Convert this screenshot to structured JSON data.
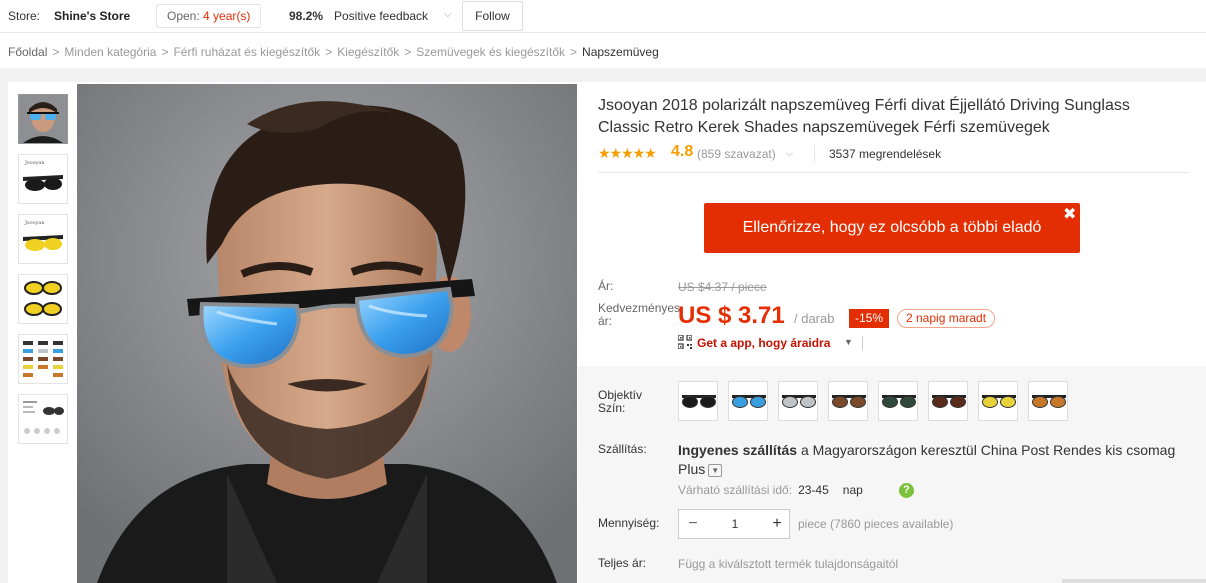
{
  "store": {
    "label": "Store:",
    "name": "Shine's Store",
    "open_prefix": "Open:",
    "open_years": "4 year(s)",
    "feedback_pct": "98.2%",
    "feedback_label": "Positive feedback",
    "follow_label": "Follow"
  },
  "breadcrumb": [
    "Főoldal",
    "Minden kategória",
    "Férfi ruházat és kiegészítők",
    "Kiegészítők",
    "Szemüvegek és kiegészítők",
    "Napszemüveg"
  ],
  "breadcrumb_separator": ">",
  "product": {
    "title": "Jsooyan 2018 polarizált napszemüveg Férfi divat Éjjellátó Driving Sunglass Classic Retro Kerek Shades napszemüvegek Férfi szemüvegek",
    "stars": "★★★★★",
    "rating": "4.8",
    "votes": "(859 szavazat)",
    "orders": "3537 megrendelések",
    "rating_value": 4.8
  },
  "cheaper_banner": "Ellenőrizze, hogy ez olcsóbb a többi eladó",
  "cheaper_close": "✖",
  "price": {
    "label": "Ár:",
    "old": "US $4.37 / piece",
    "discount_label": "Kedvezményes ár:",
    "new": "US $ 3.71",
    "per_unit": "/ darab",
    "discount_badge": "-15%",
    "days_left": "2 napig maradt",
    "app_link": "Get a app, hogy áraidra"
  },
  "options": {
    "label": "Objektív Szín:",
    "swatches": [
      {
        "name": "black",
        "lens": "#1b1b1b"
      },
      {
        "name": "blue",
        "lens": "#3a9fe0"
      },
      {
        "name": "silver",
        "lens": "#bfc4c8"
      },
      {
        "name": "brown",
        "lens": "#7a4a2a"
      },
      {
        "name": "green",
        "lens": "#2f4a3a"
      },
      {
        "name": "dark-brown",
        "lens": "#5a2a1a"
      },
      {
        "name": "yellow",
        "lens": "#e8d23a"
      },
      {
        "name": "orange",
        "lens": "#c8782a"
      }
    ]
  },
  "shipping": {
    "label": "Szállítás:",
    "free": "Ingyenes szállítás",
    "rest": " a Magyarországon keresztül China Post Rendes kis csomag Plus",
    "est_label": "Várható szállítási idő:",
    "est_days": "23-45",
    "est_unit": "nap",
    "help": "?"
  },
  "quantity": {
    "label": "Mennyiség:",
    "minus": "−",
    "value": "1",
    "plus": "+",
    "available": "piece (7860 pieces available)"
  },
  "total": {
    "label": "Teljes ár:",
    "text": "Függ a kiválsztott termék tulajdonságaitól"
  },
  "colors": {
    "accent_red": "#e32e03",
    "price_red": "#e62e04",
    "star_orange": "#f79d00"
  }
}
